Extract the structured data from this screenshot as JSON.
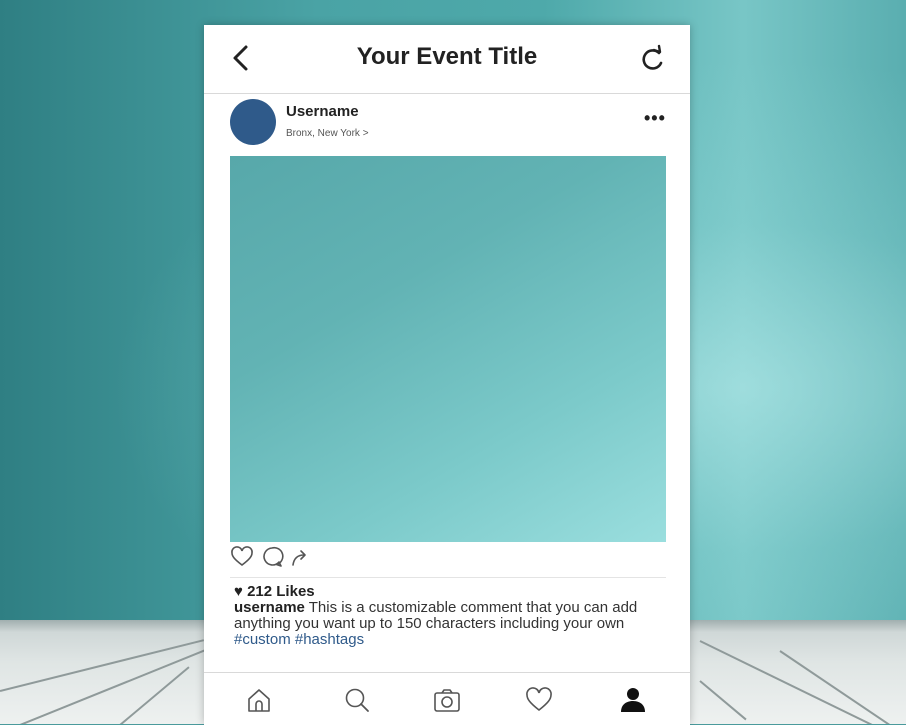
{
  "nav": {
    "back_icon": "back-chevron-icon",
    "title": "Your Event Title",
    "refresh_icon": "refresh-icon"
  },
  "post": {
    "username": "Username",
    "location": "Bronx, New York >",
    "more_icon": "more-dots-icon"
  },
  "actions": [
    "heart-icon",
    "comment-icon",
    "share-icon"
  ],
  "likes": "♥ 212 Likes",
  "caption": {
    "user": "username",
    "text": " This is a customizable comment that you can add anything you want up to 150 characters including your own ",
    "hashtags": "#custom #hashtags"
  },
  "tabbar": [
    "home-icon",
    "search-icon",
    "camera-icon",
    "heart-icon",
    "profile-icon"
  ],
  "colors": {
    "avatar": "#2f5a8a",
    "hashtag": "#2f5a8a",
    "photo": "#62b3b4",
    "wall": "#4aa3a5"
  }
}
